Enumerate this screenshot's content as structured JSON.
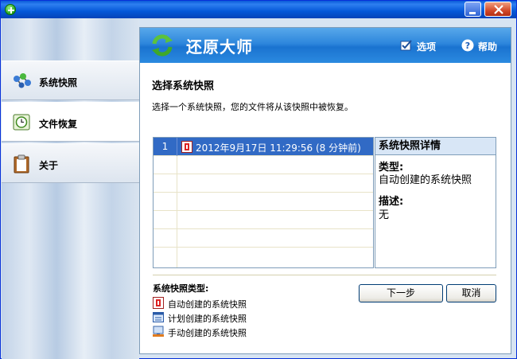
{
  "window": {
    "title": ""
  },
  "sidebar": {
    "items": [
      {
        "label": "系统快照",
        "icon": "molecule-icon"
      },
      {
        "label": "文件恢复",
        "icon": "clock-icon"
      },
      {
        "label": "关于",
        "icon": "clipboard-icon"
      }
    ]
  },
  "header": {
    "title": "还原大师",
    "options_label": "选项",
    "help_label": "帮助"
  },
  "content": {
    "title": "选择系统快照",
    "description": "选择一个系统快照，您的文件将从该快照中被恢复。"
  },
  "snapshots": [
    {
      "num": "1",
      "label": "2012年9月17日 11:29:56 (8 分钟前)",
      "type": "auto"
    }
  ],
  "details": {
    "header": "系统快照详情",
    "type_label": "类型:",
    "type_value": "自动创建的系统快照",
    "desc_label": "描述:",
    "desc_value": "无"
  },
  "legend": {
    "title": "系统快照类型:",
    "items": [
      {
        "label": "自动创建的系统快照",
        "icon": "auto-snapshot-icon"
      },
      {
        "label": "计划创建的系统快照",
        "icon": "scheduled-snapshot-icon"
      },
      {
        "label": "手动创建的系统快照",
        "icon": "manual-snapshot-icon"
      }
    ]
  },
  "buttons": {
    "next": "下一步",
    "cancel": "取消"
  },
  "colors": {
    "selection": "#316ac5",
    "header": "#2d86dc",
    "title_bar": "#0558d8"
  }
}
